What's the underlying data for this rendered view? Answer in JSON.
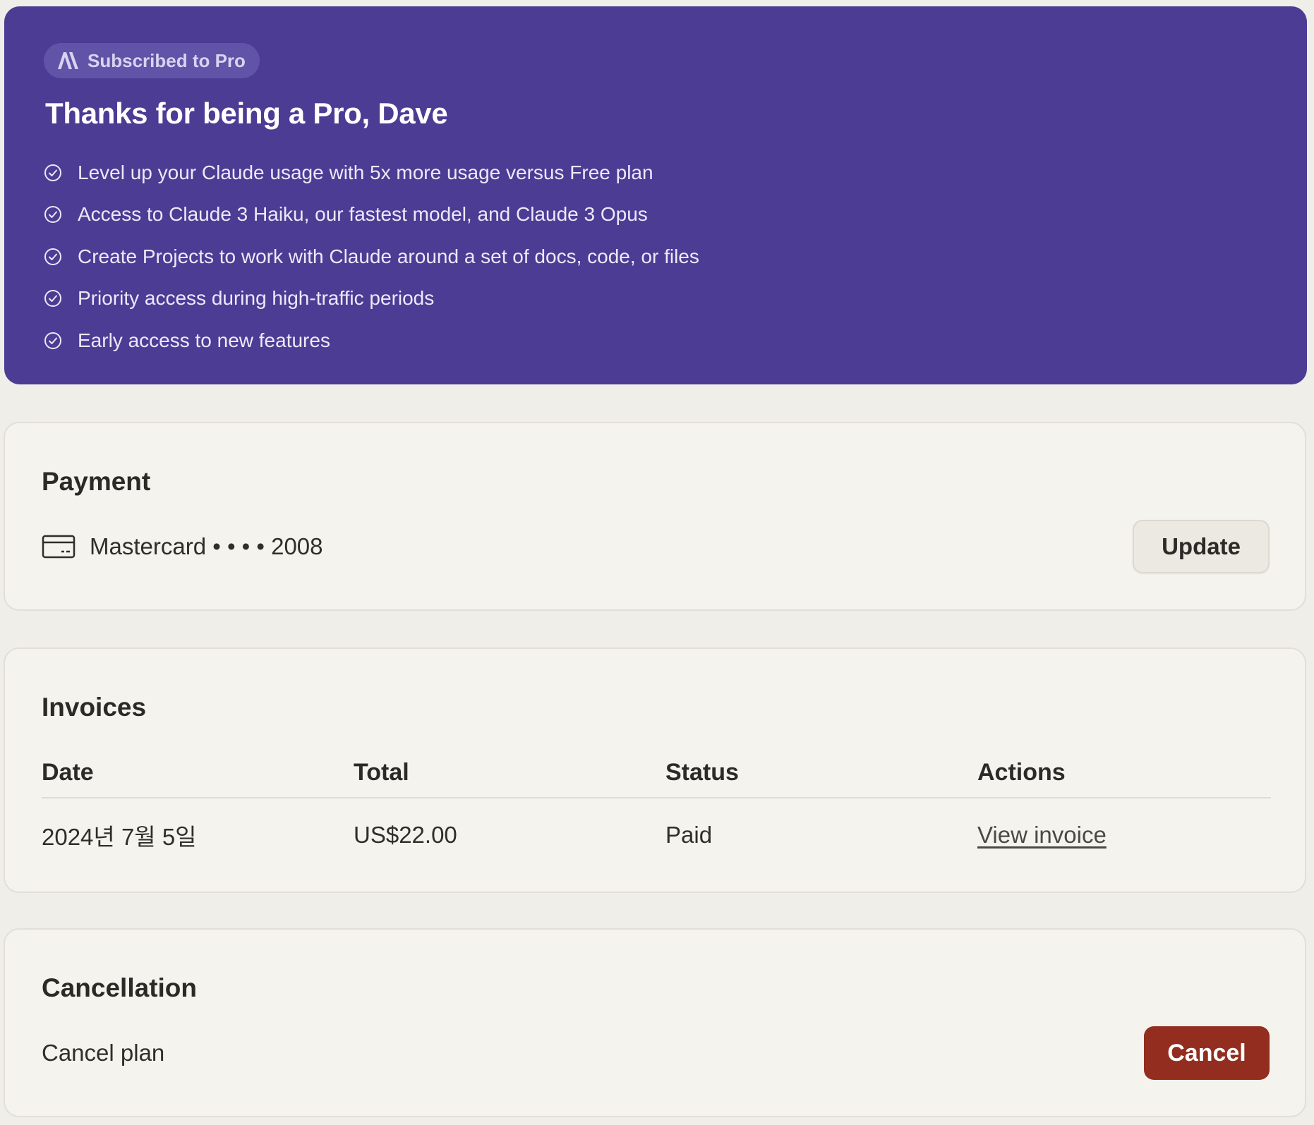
{
  "hero": {
    "badge_label": "Subscribed to Pro",
    "title": "Thanks for being a Pro, Dave",
    "features": [
      "Level up your Claude usage with 5x more usage versus Free plan",
      "Access to Claude 3 Haiku, our fastest model, and Claude 3 Opus",
      "Create Projects to work with Claude around a set of docs, code, or files",
      "Priority access during high-traffic periods",
      "Early access to new features"
    ],
    "icons": {
      "badge": "anthropic-logo-icon",
      "feature": "check-circle-icon"
    },
    "colors": {
      "background": "#4c3c94",
      "badge_background": "#6153a7"
    }
  },
  "payment": {
    "title": "Payment",
    "card_label": "Mastercard • • • • 2008",
    "card_icon": "credit-card-icon",
    "update_label": "Update"
  },
  "invoices": {
    "title": "Invoices",
    "columns": [
      "Date",
      "Total",
      "Status",
      "Actions"
    ],
    "rows": [
      {
        "date": "2024년 7월 5일",
        "total": "US$22.00",
        "status": "Paid",
        "action": "View invoice"
      }
    ]
  },
  "cancellation": {
    "title": "Cancellation",
    "text": "Cancel plan",
    "button_label": "Cancel",
    "button_color": "#922d1f"
  }
}
